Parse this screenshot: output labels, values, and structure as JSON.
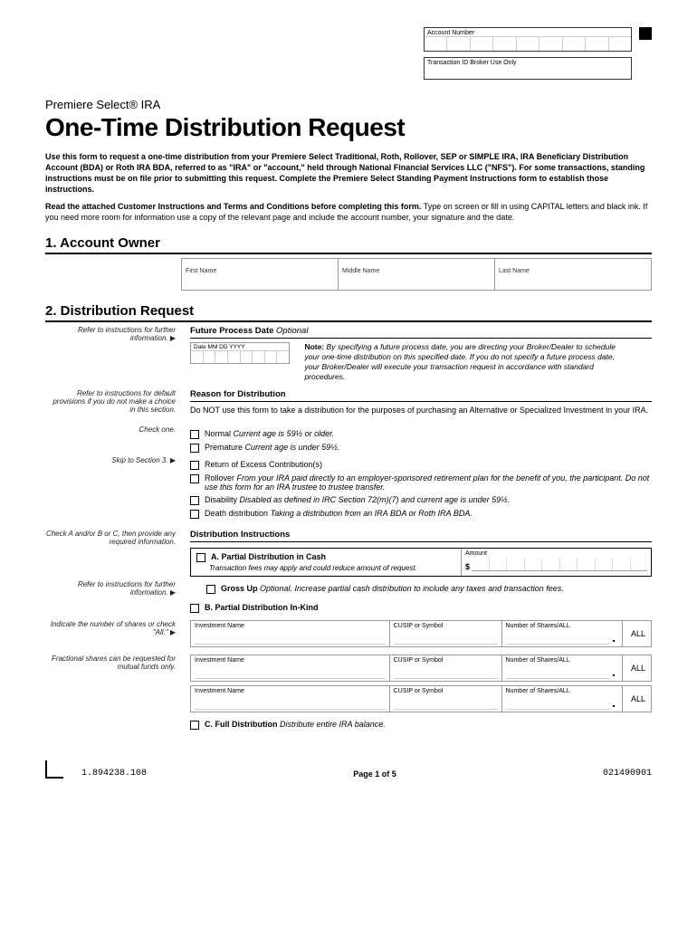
{
  "header": {
    "account_number_label": "Account Number",
    "transaction_id_label": "Transaction ID Broker Use Only",
    "pretitle": "Premiere Select® IRA",
    "title": "One-Time Distribution Request"
  },
  "intro": {
    "p1": "Use this form to request a one-time distribution from your Premiere Select Traditional, Roth, Rollover, SEP or SIMPLE IRA, IRA Beneficiary Distribution Account (BDA) or Roth IRA BDA, referred to as \"IRA\" or \"account,\" held through National Financial Services LLC (\"NFS\"). For some transactions, standing instructions must be on file prior to submitting this request. Complete the Premiere Select Standing Payment Instructions form to establish those instructions.",
    "p2a": "Read the attached Customer Instructions and Terms and Conditions before completing this form.",
    "p2b": " Type on screen or fill in using CAPITAL letters and black ink. If you need more room for information use a copy of the relevant page and include the account number, your signature and the date."
  },
  "section1": {
    "title": "1. Account Owner",
    "first_name": "First Name",
    "middle_name": "Middle Name",
    "last_name": "Last Name"
  },
  "section2": {
    "title": "2. Distribution Request",
    "future_process": {
      "heading": "Future Process Date",
      "optional": "Optional",
      "date_label": "Date MM DD YYYY",
      "note_bold": "Note:",
      "note": " By specifying a future process date, you are directing your Broker/Dealer to schedule your one-time distribution on this specified date. If you do not specify a future process date, your Broker/Dealer will execute your transaction request in accordance with standard procedures.",
      "left_hint": "Refer to instructions for further information."
    },
    "reason": {
      "heading": "Reason for Distribution",
      "left_hint1": "Refer to instructions for default provisions if you do not make a choice in this section.",
      "left_hint2": "Check one.",
      "left_hint3": "Skip to Section 3.",
      "warn": "Do NOT use this form to take a distribution for the purposes of purchasing an Alternative or Specialized Investment in your IRA.",
      "opt_normal": "Normal",
      "opt_normal_i": "Current age is 59½ or older.",
      "opt_premature": "Premature",
      "opt_premature_i": "Current age is under 59½.",
      "opt_return": "Return of Excess Contribution(s)",
      "opt_rollover": "Rollover",
      "opt_rollover_i": "From your IRA paid directly to an employer-sponsored retirement plan for the benefit of you, the participant. Do not use this form for an IRA trustee to trustee transfer.",
      "opt_disability": "Disability",
      "opt_disability_i": "Disabled as defined in IRC Section 72(m)(7) and current age is under 59½.",
      "opt_death": "Death distribution",
      "opt_death_i": "Taking a distribution from an IRA BDA or Roth IRA BDA."
    },
    "instructions": {
      "heading": "Distribution Instructions",
      "left_hint_a": "Check A and/or B or C, then provide any required information.",
      "left_hint_b": "Refer to instructions for further information.",
      "a_title": "A. Partial Distribution in Cash",
      "a_sub": "Transaction fees may apply and could reduce amount of request.",
      "amount_label": "Amount",
      "gross_up_b": "Gross Up",
      "gross_up_i": "Optional. Increase partial cash distribution to include any taxes and transaction fees.",
      "b_title": "B. Partial Distribution In-Kind",
      "left_hint_c": "Indicate the number of shares or check \"All.\"",
      "left_hint_d": "Fractional shares can be requested for mutual funds only.",
      "inv_name": "Investment Name",
      "cusip": "CUSIP or Symbol",
      "shares": "Number of Shares/ALL",
      "all": "ALL",
      "c_title": "C. Full Distribution",
      "c_sub": "Distribute entire IRA balance."
    }
  },
  "footer": {
    "left": "1.894238.108",
    "center": "Page 1 of 5",
    "right": "021490901"
  }
}
